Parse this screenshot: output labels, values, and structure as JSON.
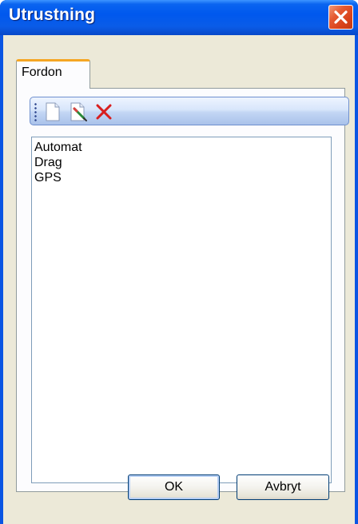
{
  "window": {
    "title": "Utrustning"
  },
  "tabs": [
    {
      "label": "Fordon",
      "selected": true
    }
  ],
  "toolbar": {
    "buttons": [
      {
        "icon": "new-document-icon"
      },
      {
        "icon": "edit-icon"
      },
      {
        "icon": "delete-icon"
      }
    ]
  },
  "list": {
    "items": [
      "Automat",
      "Drag",
      "GPS"
    ]
  },
  "buttons": {
    "ok_label": "OK",
    "cancel_label": "Avbryt"
  },
  "colors": {
    "titlebar": "#0058ee",
    "client": "#ece9d8",
    "tab_accent": "#f5a623",
    "close": "#d8421a",
    "delete_icon": "#d81e1e"
  }
}
